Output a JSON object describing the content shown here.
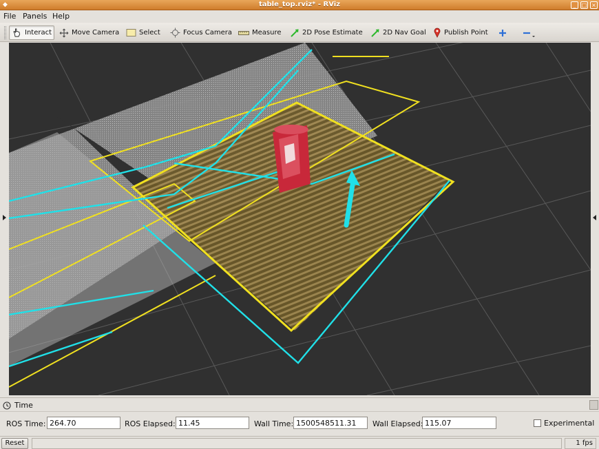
{
  "window": {
    "title": "table_top.rviz* - RViz"
  },
  "menu": {
    "items": [
      "File",
      "Panels",
      "Help"
    ]
  },
  "toolbar": {
    "tools": [
      {
        "label": "Interact",
        "icon": "hand-pointer-icon",
        "active": true
      },
      {
        "label": "Move Camera",
        "icon": "move-arrows-icon",
        "active": false
      },
      {
        "label": "Select",
        "icon": "select-rectangle-icon",
        "active": false
      },
      {
        "label": "Focus Camera",
        "icon": "focus-crosshair-icon",
        "active": false
      },
      {
        "label": "Measure",
        "icon": "ruler-icon",
        "active": false
      },
      {
        "label": "2D Pose Estimate",
        "icon": "green-arrow-icon",
        "active": false
      },
      {
        "label": "2D Nav Goal",
        "icon": "green-arrow-icon",
        "active": false
      },
      {
        "label": "Publish Point",
        "icon": "red-pin-icon",
        "active": false
      }
    ],
    "add_icon": "plus-icon",
    "remove_icon": "minus-icon"
  },
  "time_panel": {
    "title": "Time",
    "ros_time": {
      "label": "ROS Time:",
      "value": "264.70"
    },
    "ros_elapsed": {
      "label": "ROS Elapsed:",
      "value": "11.45"
    },
    "wall_time": {
      "label": "Wall Time:",
      "value": "1500548511.31"
    },
    "wall_elapsed": {
      "label": "Wall Elapsed:",
      "value": "115.07"
    },
    "experimental": {
      "label": "Experimental",
      "checked": false
    }
  },
  "status": {
    "reset_label": "Reset",
    "fps": "1 fps"
  },
  "colors": {
    "background": "#303030",
    "grid": "#5a5a5a",
    "marker_yellow": "#f0e020",
    "marker_cyan": "#20e0e8",
    "table_plane": "#6b5a2e",
    "can_red": "#c8283a"
  }
}
